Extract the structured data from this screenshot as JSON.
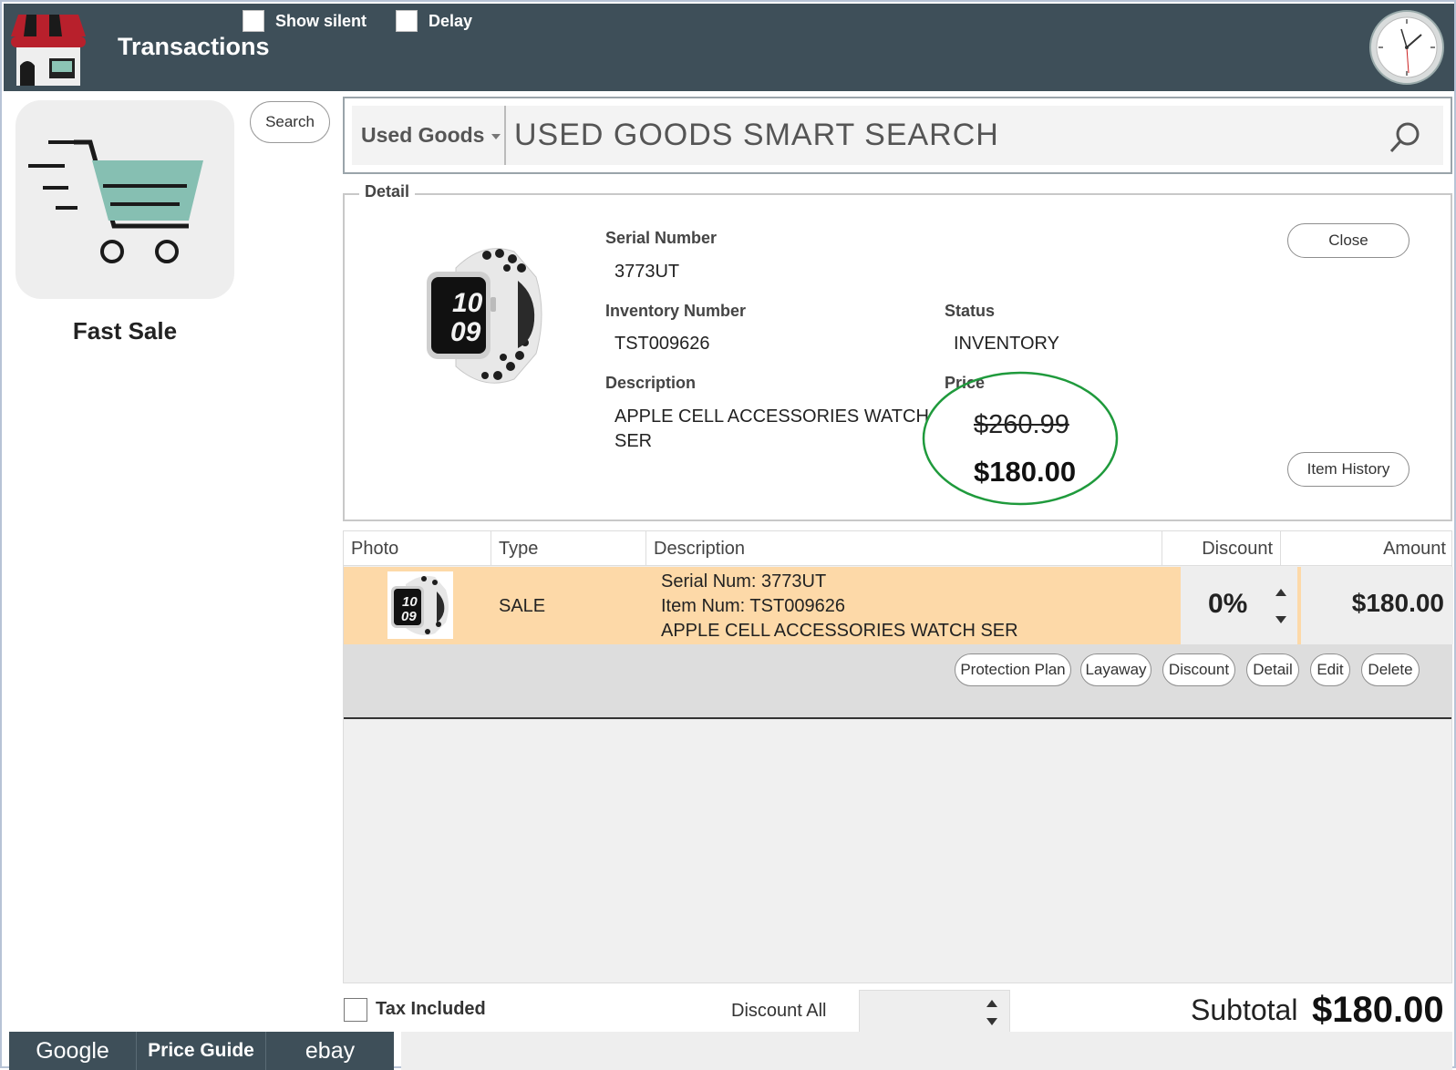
{
  "header": {
    "title": "Transactions",
    "show_silent_label": "Show silent",
    "delay_label": "Delay"
  },
  "left": {
    "fast_sale_label": "Fast Sale",
    "search_button": "Search"
  },
  "search": {
    "category": "Used Goods",
    "value": "USED GOODS SMART SEARCH"
  },
  "detail": {
    "legend": "Detail",
    "serial_label": "Serial Number",
    "serial_value": "3773UT",
    "inventory_label": "Inventory Number",
    "inventory_value": "TST009626",
    "status_label": "Status",
    "status_value": "INVENTORY",
    "description_label": "Description",
    "description_line1": "APPLE CELL ACCESSORIES WATCH",
    "description_line2": "SER",
    "price_label": "Price",
    "price_old": "$260.99",
    "price_new": "$180.00",
    "close_button": "Close",
    "item_history_button": "Item History",
    "watch_time_hour": "10",
    "watch_time_min": "09",
    "highlight_color": "#1f9a3c"
  },
  "grid": {
    "headers": [
      "Photo",
      "Type",
      "Description",
      "Discount",
      "Amount"
    ],
    "row": {
      "type": "SALE",
      "desc_line1": "Serial Num: 3773UT",
      "desc_line2": "Item Num: TST009626",
      "desc_line3": "APPLE CELL ACCESSORIES WATCH SER",
      "discount": "0%",
      "amount": "$180.00",
      "row_color": "#fdd9a8"
    },
    "actions": [
      "Protection Plan",
      "Layaway",
      "Discount",
      "Detail",
      "Edit",
      "Delete"
    ]
  },
  "footer": {
    "tax_included_label": "Tax Included",
    "discount_all_label": "Discount All",
    "subtotal_label": "Subtotal",
    "subtotal_value": "$180.00"
  },
  "bottom_bar": {
    "google": "Google",
    "price_guide": "Price Guide",
    "ebay": "ebay"
  }
}
